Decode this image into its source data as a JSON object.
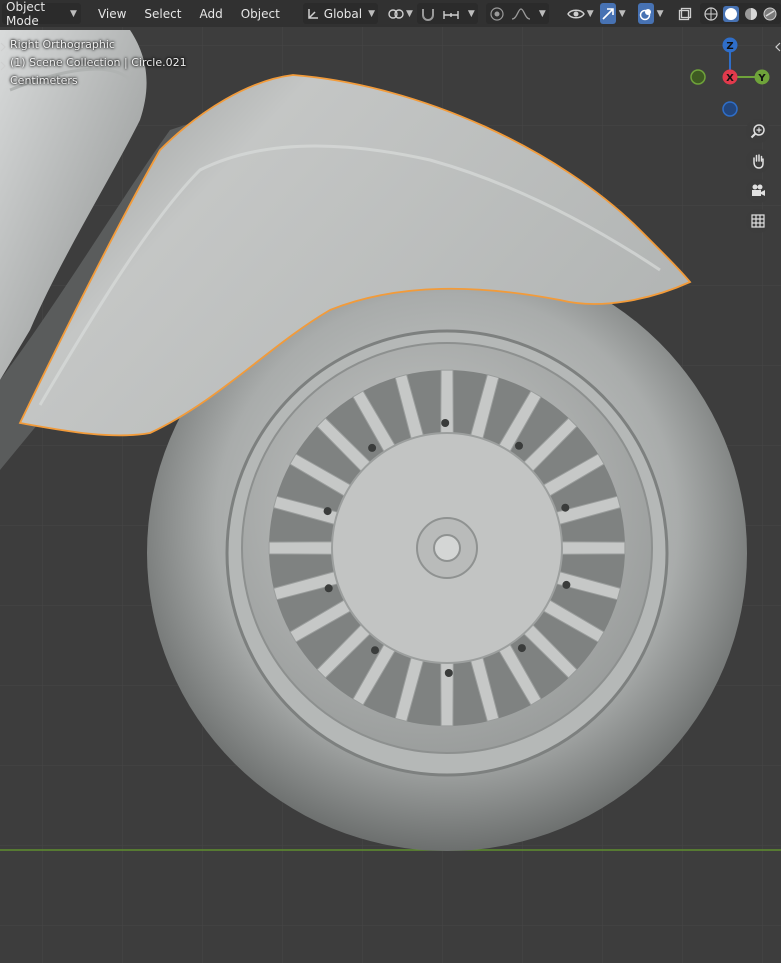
{
  "header": {
    "mode": "Object Mode",
    "menus": [
      "View",
      "Select",
      "Add",
      "Object"
    ],
    "transform_orientation": "Global"
  },
  "overlay": {
    "view_name": "Right Orthographic",
    "collection_line": "(1) Scene Collection | Circle.021",
    "units": "Centimeters"
  },
  "gizmo": {
    "z_label": "Z",
    "x_label": "X",
    "y_label": "Y",
    "z_color": "#2f6ec9",
    "x_color": "#e23a4c",
    "y_color": "#6fa33a"
  },
  "colors": {
    "background": "#3d3d3d",
    "grid": "#4a4a4a",
    "selection_outline": "#f29b3a",
    "ground_line": "#5f8f2e"
  },
  "icons": [
    "zoom-icon",
    "hand-pan-icon",
    "camera-icon",
    "grid-icon"
  ]
}
